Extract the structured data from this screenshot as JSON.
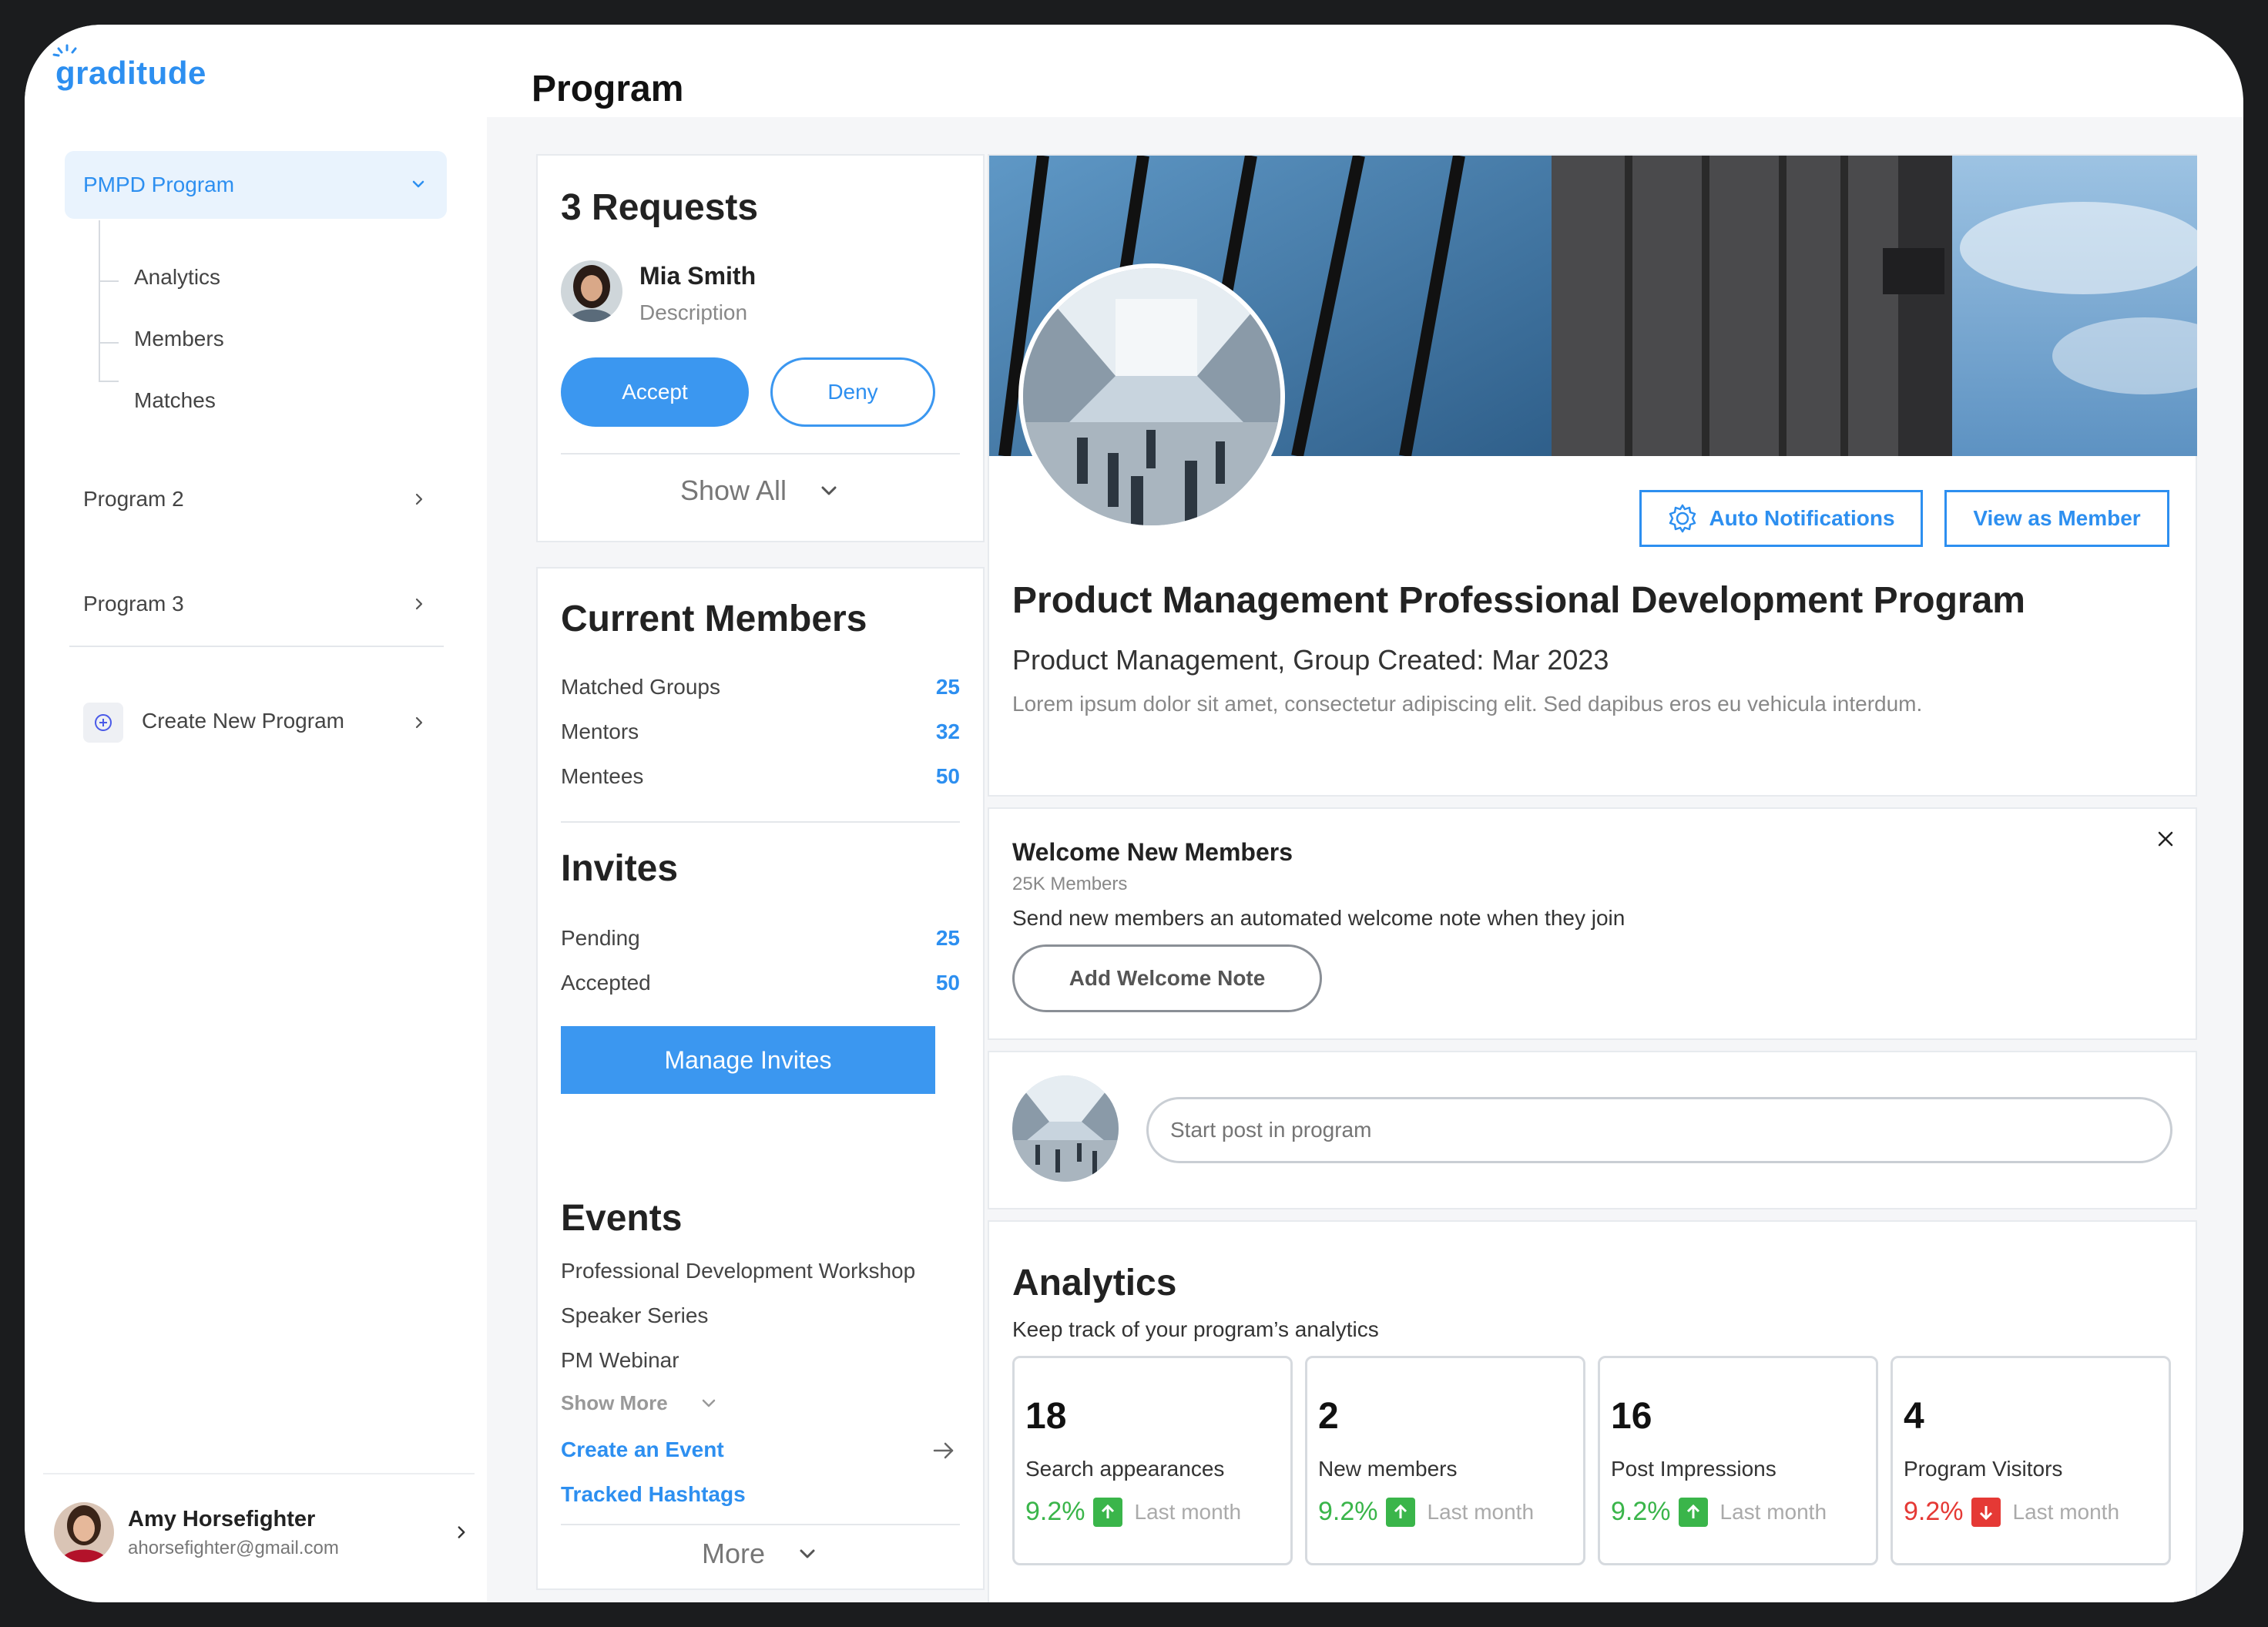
{
  "app": {
    "logo_text": "raditude",
    "logo_g": "g"
  },
  "header": {
    "title": "Program"
  },
  "sidebar": {
    "active_program": "PMPD Program",
    "sub_items": [
      "Analytics",
      "Members",
      "Matches"
    ],
    "programs": [
      "Program 2",
      "Program 3"
    ],
    "create_label": "Create New Program"
  },
  "user": {
    "name": "Amy Horsefighter",
    "email": "ahorsefighter@gmail.com"
  },
  "requests": {
    "title": "3 Requests",
    "requester_name": "Mia Smith",
    "requester_desc": "Description",
    "accept_label": "Accept",
    "deny_label": "Deny",
    "show_all_label": "Show All"
  },
  "members": {
    "title": "Current Members",
    "rows": [
      {
        "label": "Matched Groups",
        "value": "25"
      },
      {
        "label": "Mentors",
        "value": "32"
      },
      {
        "label": "Mentees",
        "value": "50"
      }
    ]
  },
  "invites": {
    "title": "Invites",
    "rows": [
      {
        "label": "Pending",
        "value": "25"
      },
      {
        "label": "Accepted",
        "value": "50"
      }
    ],
    "manage_label": "Manage Invites"
  },
  "events": {
    "title": "Events",
    "items": [
      "Professional Development Workshop",
      "Speaker Series",
      "PM Webinar"
    ],
    "show_more_label": "Show More",
    "create_label": "Create an Event",
    "hashtags_label": "Tracked Hashtags",
    "more_label": "More"
  },
  "profile": {
    "auto_notifications_label": "Auto Notifications",
    "view_as_member_label": "View as Member",
    "title": "Product Management Professional Development Program",
    "subtitle": "Product Management, Group Created: Mar 2023",
    "description": "Lorem ipsum dolor sit amet, consectetur adipiscing elit. Sed dapibus eros eu vehicula interdum."
  },
  "welcome": {
    "title": "Welcome New Members",
    "count": "25K Members",
    "text": "Send new members an automated welcome note when they join",
    "button_label": "Add Welcome Note"
  },
  "post": {
    "placeholder": "Start post in program"
  },
  "analytics": {
    "title": "Analytics",
    "subtitle": "Keep track of your program’s analytics",
    "metrics": [
      {
        "value": "18",
        "label": "Search appearances",
        "change": "9.2%",
        "direction": "up",
        "period": "Last month"
      },
      {
        "value": "2",
        "label": "New members",
        "change": "9.2%",
        "direction": "up",
        "period": "Last month"
      },
      {
        "value": "16",
        "label": "Post Impressions",
        "change": "9.2%",
        "direction": "up",
        "period": "Last month"
      },
      {
        "value": "4",
        "label": "Program Visitors",
        "change": "9.2%",
        "direction": "down",
        "period": "Last month"
      }
    ]
  },
  "colors": {
    "accent": "#3b97f0",
    "up": "#3ab54a",
    "down": "#e53935"
  }
}
